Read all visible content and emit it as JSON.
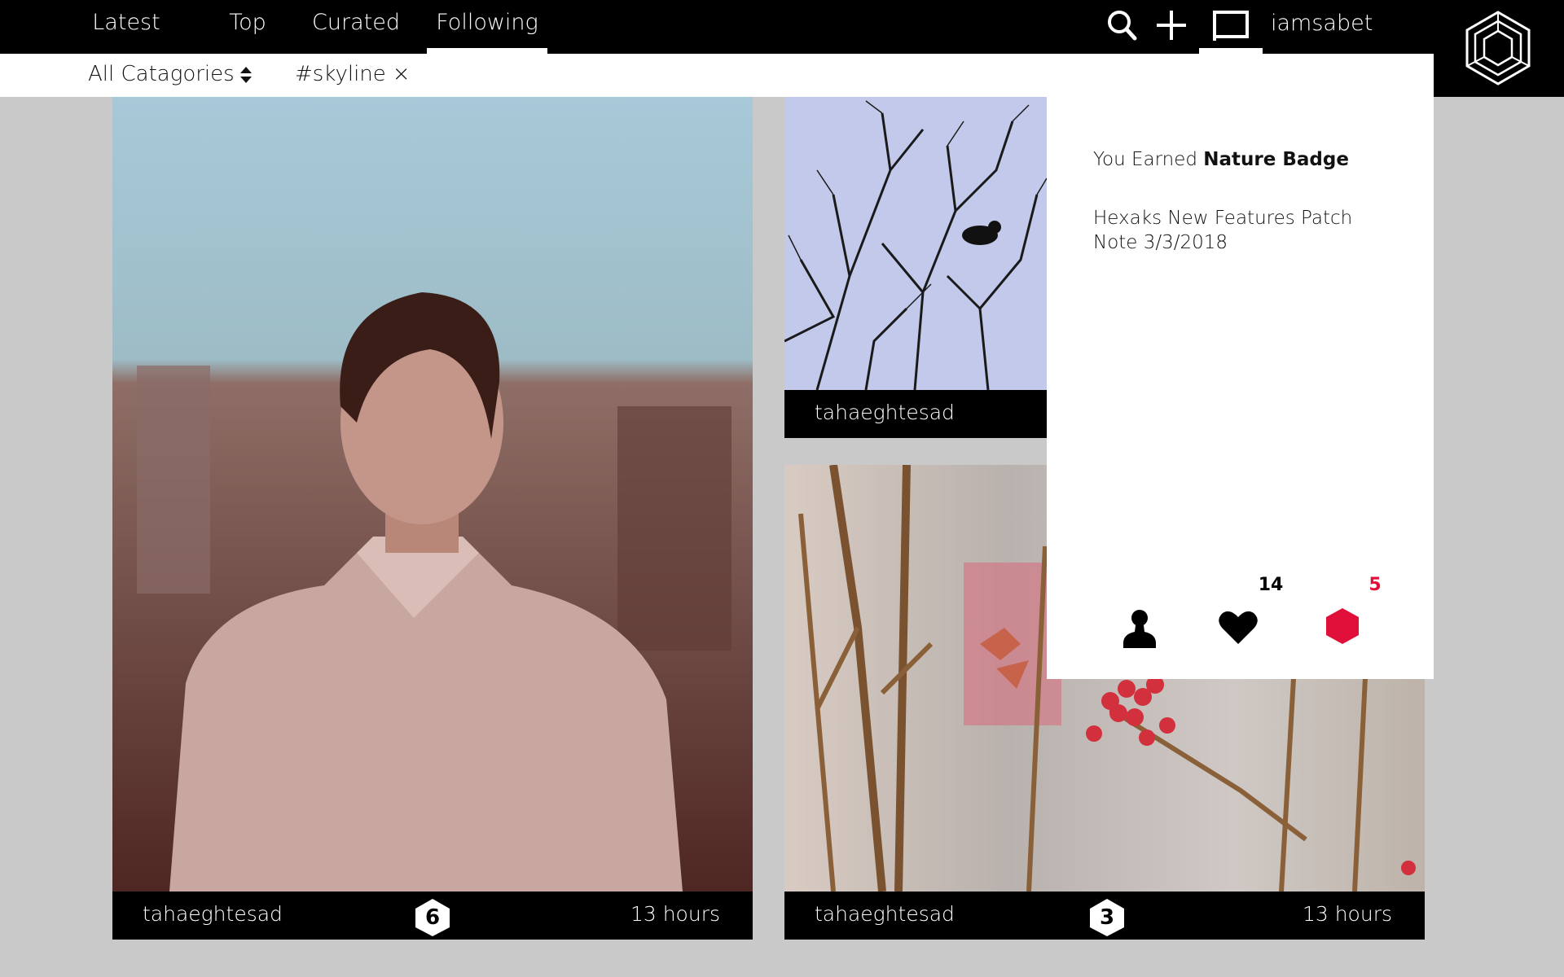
{
  "nav": {
    "tabs": [
      {
        "label": "Latest"
      },
      {
        "label": "Top"
      },
      {
        "label": "Curated"
      },
      {
        "label": "Following"
      }
    ],
    "username": "iamsabet"
  },
  "filters": {
    "category_label": "All Catagories",
    "tag_label": "#skyline",
    "tag_close": "×"
  },
  "cards": [
    {
      "author": "tahaeghtesad",
      "badge": "6",
      "time": "13 hours"
    },
    {
      "author": "tahaeghtesad"
    },
    {
      "author": "tahaeghtesad",
      "badge": "3",
      "time": "13 hours"
    }
  ],
  "panel": {
    "notif1_prefix": "You Earned ",
    "notif1_bold": "Nature Badge",
    "notif2": "Hexaks New Features Patch Note 3/3/2018",
    "likes_count": "14",
    "badges_count": "5"
  },
  "colors": {
    "accent_red": "#e0103a",
    "bar": "#000000",
    "background": "#c9c9c9"
  }
}
